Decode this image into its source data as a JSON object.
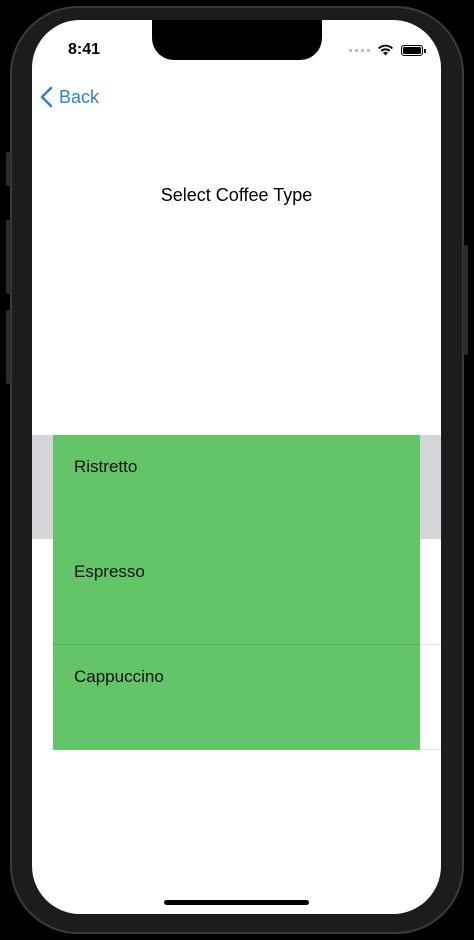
{
  "status_bar": {
    "time": "8:41",
    "icons": [
      "cellular-signal-icon",
      "wifi-icon",
      "battery-icon"
    ]
  },
  "nav": {
    "back_label": "Back",
    "back_icon": "chevron-left-icon"
  },
  "page": {
    "title": "Select Coffee Type"
  },
  "options": [
    {
      "label": "Ristretto",
      "selected": true
    },
    {
      "label": "Espresso",
      "selected": false
    },
    {
      "label": "Cappuccino",
      "selected": false
    }
  ],
  "colors": {
    "accent": "#2f7ed8",
    "option_background": "#64c468",
    "selected_row_background": "#d5d5da"
  }
}
